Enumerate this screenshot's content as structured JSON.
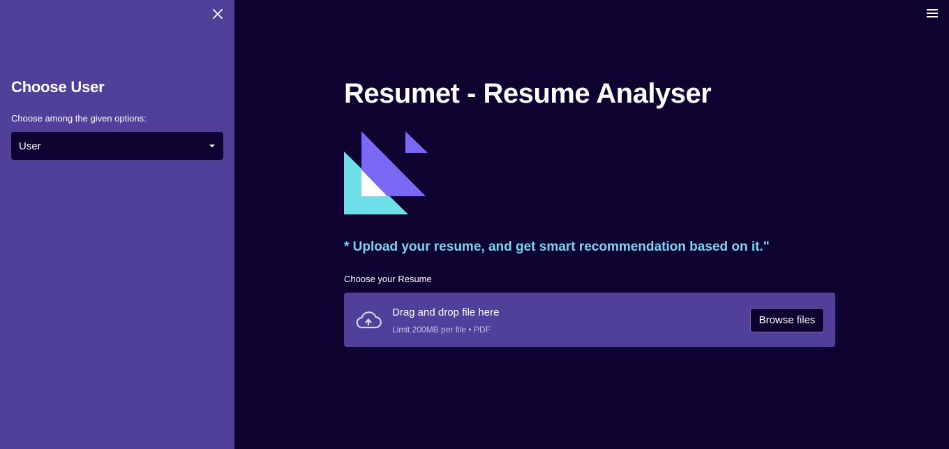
{
  "sidebar": {
    "title": "Choose User",
    "select": {
      "label": "Choose among the given options:",
      "value": "User"
    }
  },
  "main": {
    "title": "Resumet - Resume Analyser",
    "tagline": "* Upload your resume, and get smart recommendation based on it.\"",
    "uploader": {
      "label": "Choose your Resume",
      "instruction": "Drag and drop file here",
      "limit": "Limit 200MB per file • PDF",
      "browse_label": "Browse files"
    }
  },
  "colors": {
    "sidebar_bg": "#50409a",
    "main_bg": "#0e0230",
    "accent": "#7dd3f0",
    "logo_purple": "#7b68f5",
    "logo_cyan": "#6ddfe8"
  },
  "icons": {
    "close": "close-icon",
    "menu": "hamburger-menu-icon",
    "caret": "chevron-down-icon",
    "upload": "cloud-upload-icon"
  }
}
